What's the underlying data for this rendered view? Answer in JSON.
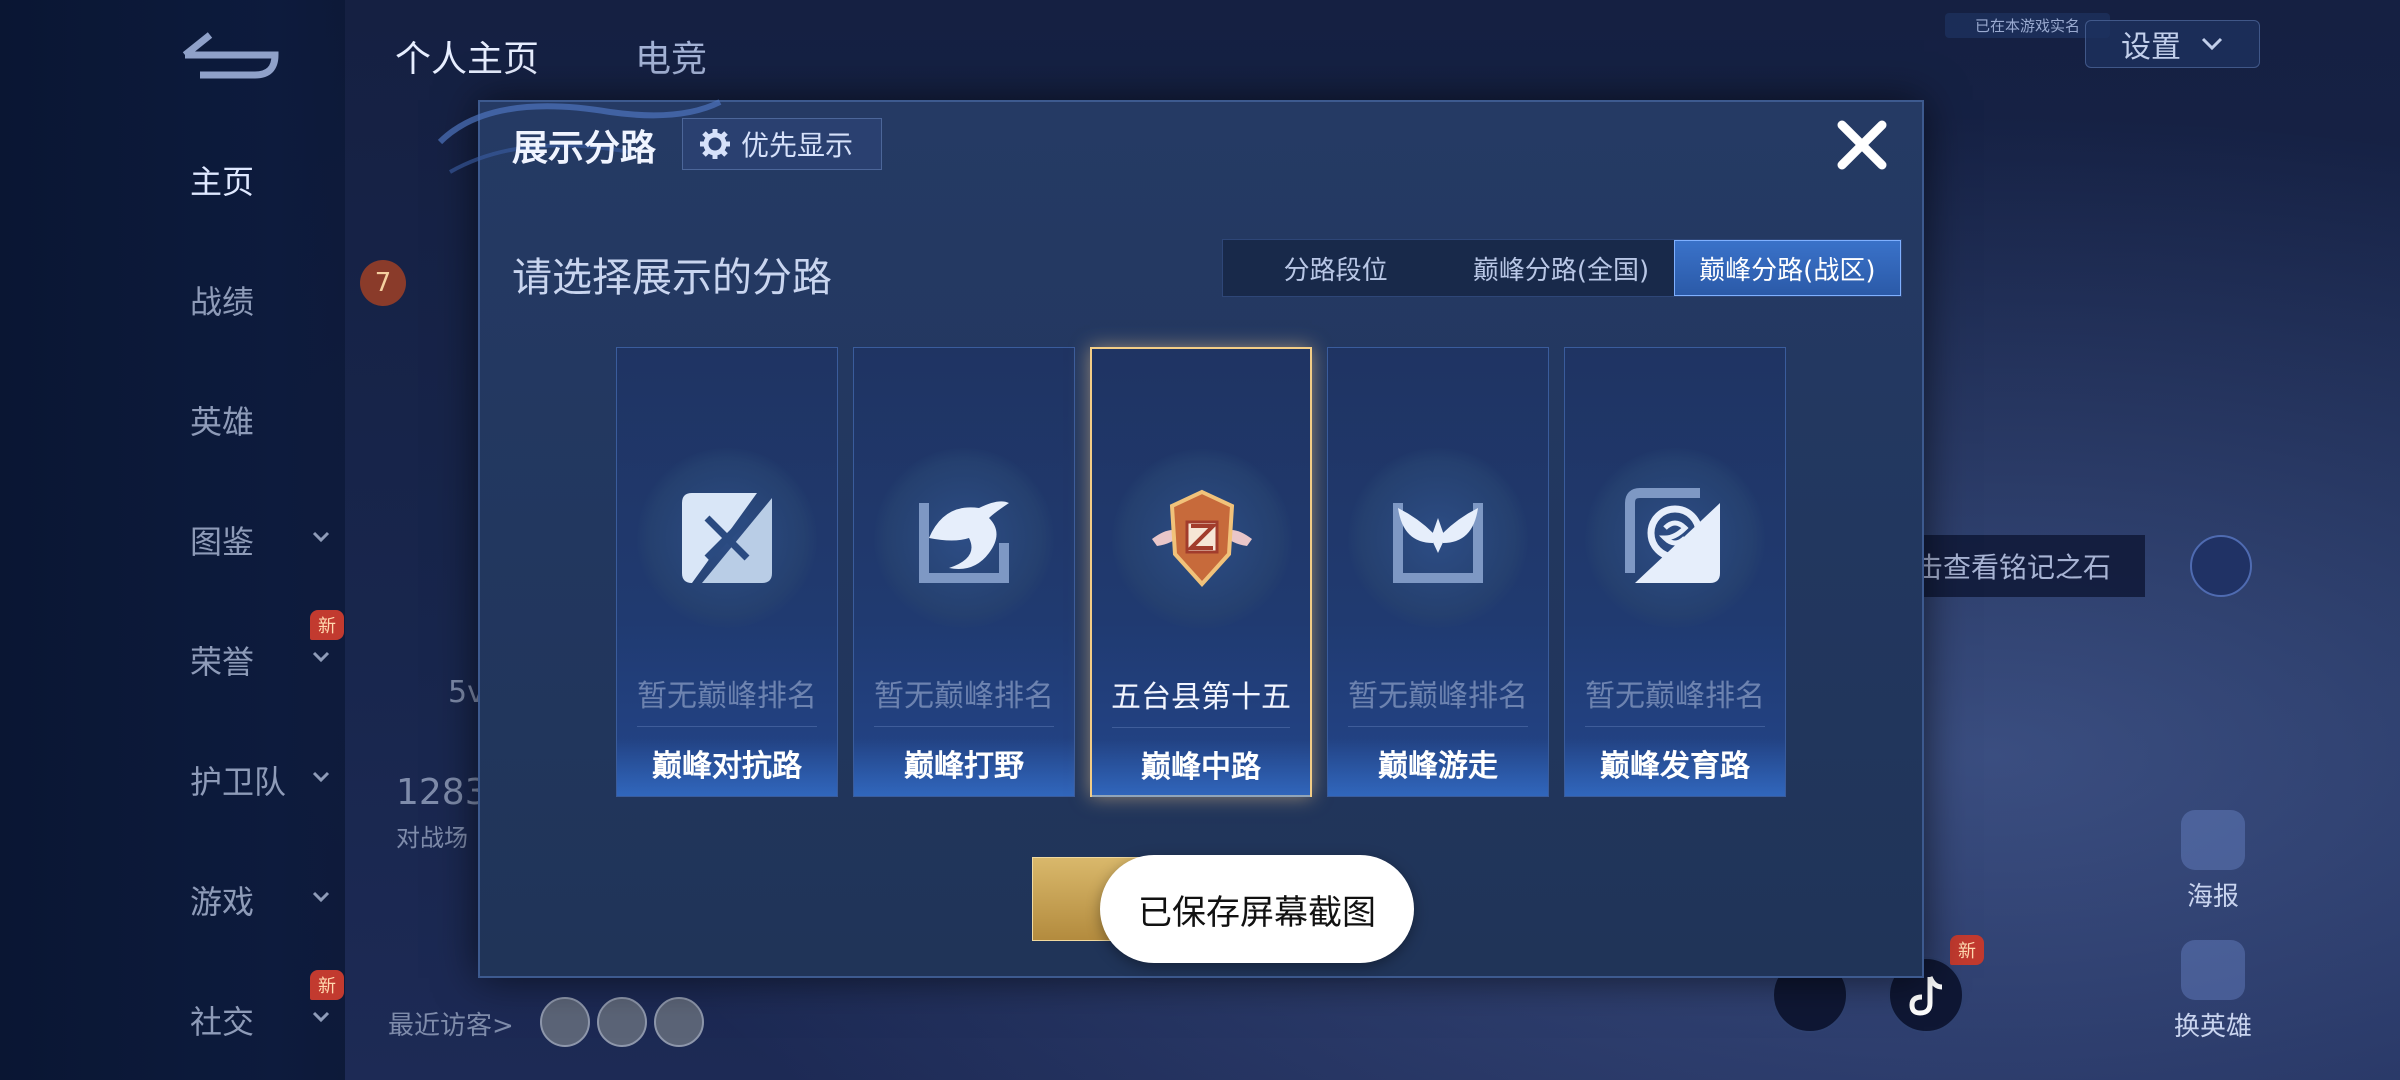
{
  "nav": {
    "items": [
      {
        "label": "主页"
      },
      {
        "label": "战绩"
      },
      {
        "label": "英雄"
      },
      {
        "label": "图鉴"
      },
      {
        "label": "荣誉"
      },
      {
        "label": "护卫队"
      },
      {
        "label": "游戏"
      },
      {
        "label": "社交"
      }
    ],
    "new_badge": "新"
  },
  "top_tabs": [
    "个人主页",
    "电竞"
  ],
  "settings": {
    "label": "设置"
  },
  "top_small_label": "已在本游戏实名",
  "inscription_tip": "击查看铭记之石",
  "side_actions": [
    {
      "label": "海报"
    },
    {
      "label": "换英雄"
    }
  ],
  "background_text": {
    "stat_1": "1283",
    "stat_1_sub": "对战场",
    "stat_2": "5v",
    "level": "7"
  },
  "visitors_label": "最近访客>",
  "dialog": {
    "title": "展示分路",
    "priority_label": "优先显示",
    "subtitle": "请选择展示的分路",
    "segments": [
      {
        "label": "分路段位",
        "active": false
      },
      {
        "label": "巅峰分路(全国)",
        "active": false
      },
      {
        "label": "巅峰分路(战区)",
        "active": true
      }
    ],
    "lanes": [
      {
        "rank": "暂无巅峰排名",
        "name": "巅峰对抗路",
        "icon": "sword-emblem-icon"
      },
      {
        "rank": "暂无巅峰排名",
        "name": "巅峰打野",
        "icon": "dragon-emblem-icon"
      },
      {
        "rank": "五台县第十五",
        "name": "巅峰中路",
        "icon": "winged-shield-emblem-icon",
        "selected": true
      },
      {
        "rank": "暂无巅峰排名",
        "name": "巅峰游走",
        "icon": "wings-emblem-icon"
      },
      {
        "rank": "暂无巅峰排名",
        "name": "巅峰发育路",
        "icon": "target-emblem-icon"
      }
    ]
  },
  "toast": "已保存屏幕截图",
  "colors": {
    "accent": "#3a72c9",
    "gold": "#f3cd86",
    "dialog_bg": "#22375f"
  }
}
